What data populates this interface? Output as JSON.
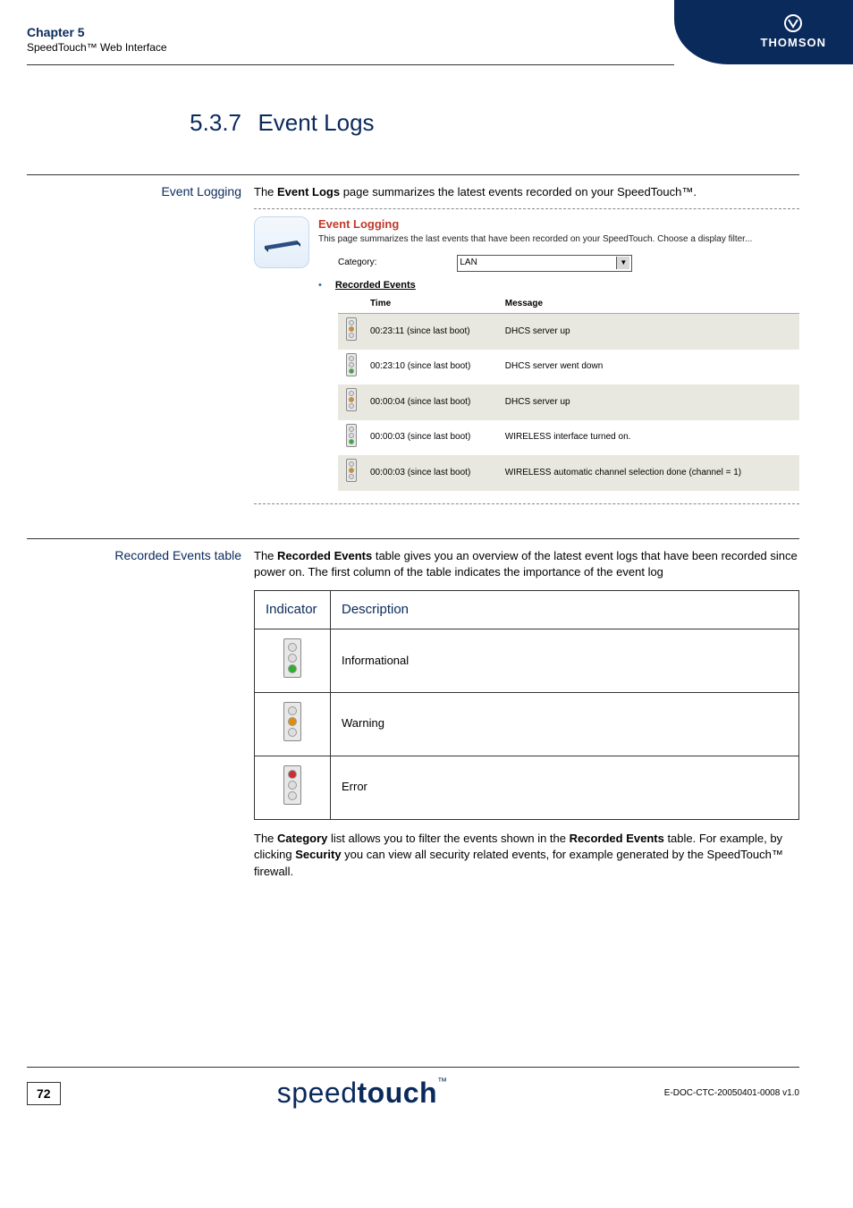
{
  "header": {
    "chapter_title": "Chapter 5",
    "chapter_sub": "SpeedTouch™ Web Interface",
    "brand": "THOMSON"
  },
  "section": {
    "number": "5.3.7",
    "title": "Event Logs"
  },
  "block1": {
    "side_label": "Event Logging",
    "intro_pre": "The ",
    "intro_bold": "Event Logs",
    "intro_post": " page summarizes the latest events recorded on your SpeedTouch™.",
    "screenshot": {
      "panel_title": "Event Logging",
      "panel_sub": "This page summarizes the last events that have been recorded on your SpeedTouch. Choose a display filter...",
      "category_label": "Category:",
      "category_value": "LAN",
      "recorded_title": "Recorded Events",
      "columns": {
        "time": "Time",
        "message": "Message"
      },
      "rows": [
        {
          "severity": "warn",
          "time": "00:23:11 (since last boot)",
          "msg": "DHCS server up"
        },
        {
          "severity": "info",
          "time": "00:23:10 (since last boot)",
          "msg": "DHCS server went down"
        },
        {
          "severity": "warn",
          "time": "00:00:04 (since last boot)",
          "msg": "DHCS server up"
        },
        {
          "severity": "info",
          "time": "00:00:03 (since last boot)",
          "msg": "WIRELESS interface turned on."
        },
        {
          "severity": "warn",
          "time": "00:00:03 (since last boot)",
          "msg": "WIRELESS automatic channel selection done (channel = 1)"
        }
      ]
    }
  },
  "block2": {
    "side_label": "Recorded Events table",
    "para1_pre": "The ",
    "para1_bold": "Recorded Events",
    "para1_post": " table gives you an overview of the latest event logs that have been recorded since power on. The first column of the table indicates the importance of the event log",
    "table": {
      "col1": "Indicator",
      "col2": "Description",
      "rows": [
        {
          "type": "info",
          "desc": "Informational"
        },
        {
          "type": "warn",
          "desc": "Warning"
        },
        {
          "type": "err",
          "desc": "Error"
        }
      ]
    },
    "para2_parts": {
      "t1": "The ",
      "b1": "Category",
      "t2": " list allows you to filter the events shown in the ",
      "b2": "Recorded Events",
      "t3": " table. For example, by clicking ",
      "b3": "Security",
      "t4": " you can view all security related events, for example generated by the SpeedTouch™ firewall."
    }
  },
  "footer": {
    "page": "72",
    "logo_thin": "speed",
    "logo_bold": "touch",
    "logo_tm": "™",
    "doc_ref": "E-DOC-CTC-20050401-0008 v1.0"
  }
}
